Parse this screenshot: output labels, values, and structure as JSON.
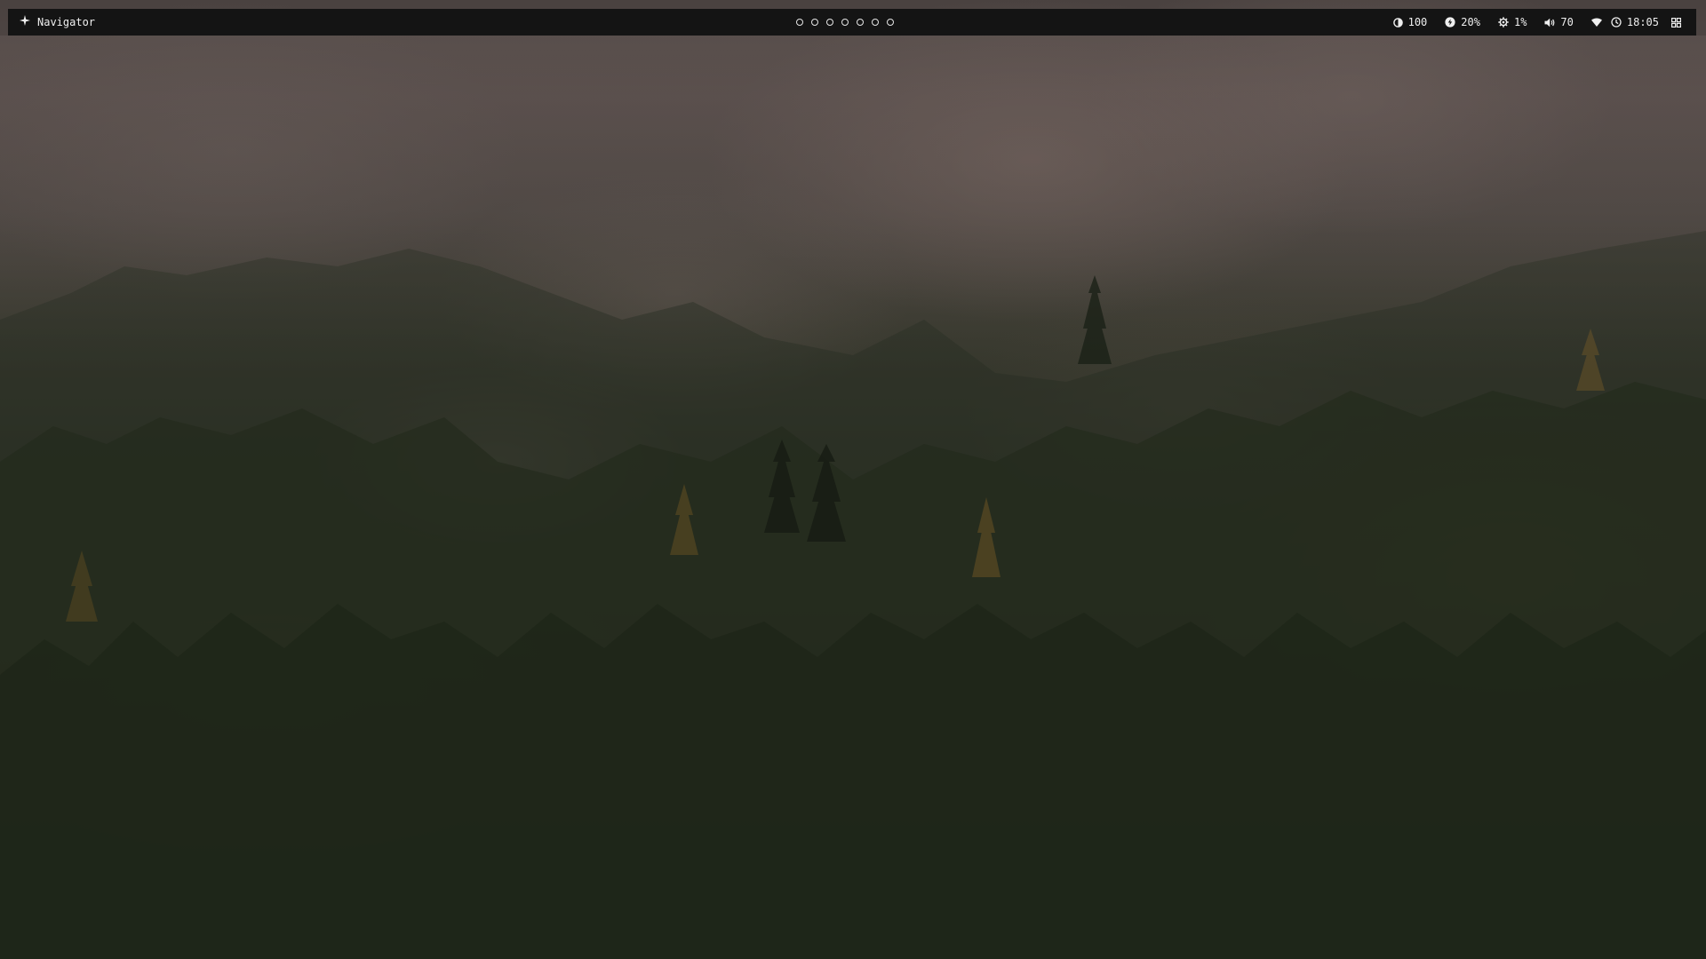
{
  "bar": {
    "background": "#141414",
    "foreground": "#e8e8e8",
    "left": {
      "launcher_icon": "sparkle-icon",
      "window_title": "Navigator"
    },
    "workspaces": {
      "count": 7,
      "active_index": null
    },
    "right": {
      "brightness": {
        "icon": "brightness-icon",
        "value": "100"
      },
      "battery": {
        "icon": "battery-circle-icon",
        "value": "20%"
      },
      "cpu": {
        "icon": "cpu-gear-icon",
        "value": "1%"
      },
      "volume": {
        "icon": "volume-icon",
        "value": "70"
      },
      "wifi": {
        "icon": "wifi-icon"
      },
      "clock": {
        "icon": "clock-icon",
        "value": "18:05"
      },
      "menu": {
        "icon": "grid-menu-icon"
      }
    }
  },
  "wallpaper": {
    "subject": "foggy-conifer-forest",
    "colors": [
      "#524846",
      "#2e3226",
      "#1a2016",
      "#7a5c26"
    ]
  }
}
